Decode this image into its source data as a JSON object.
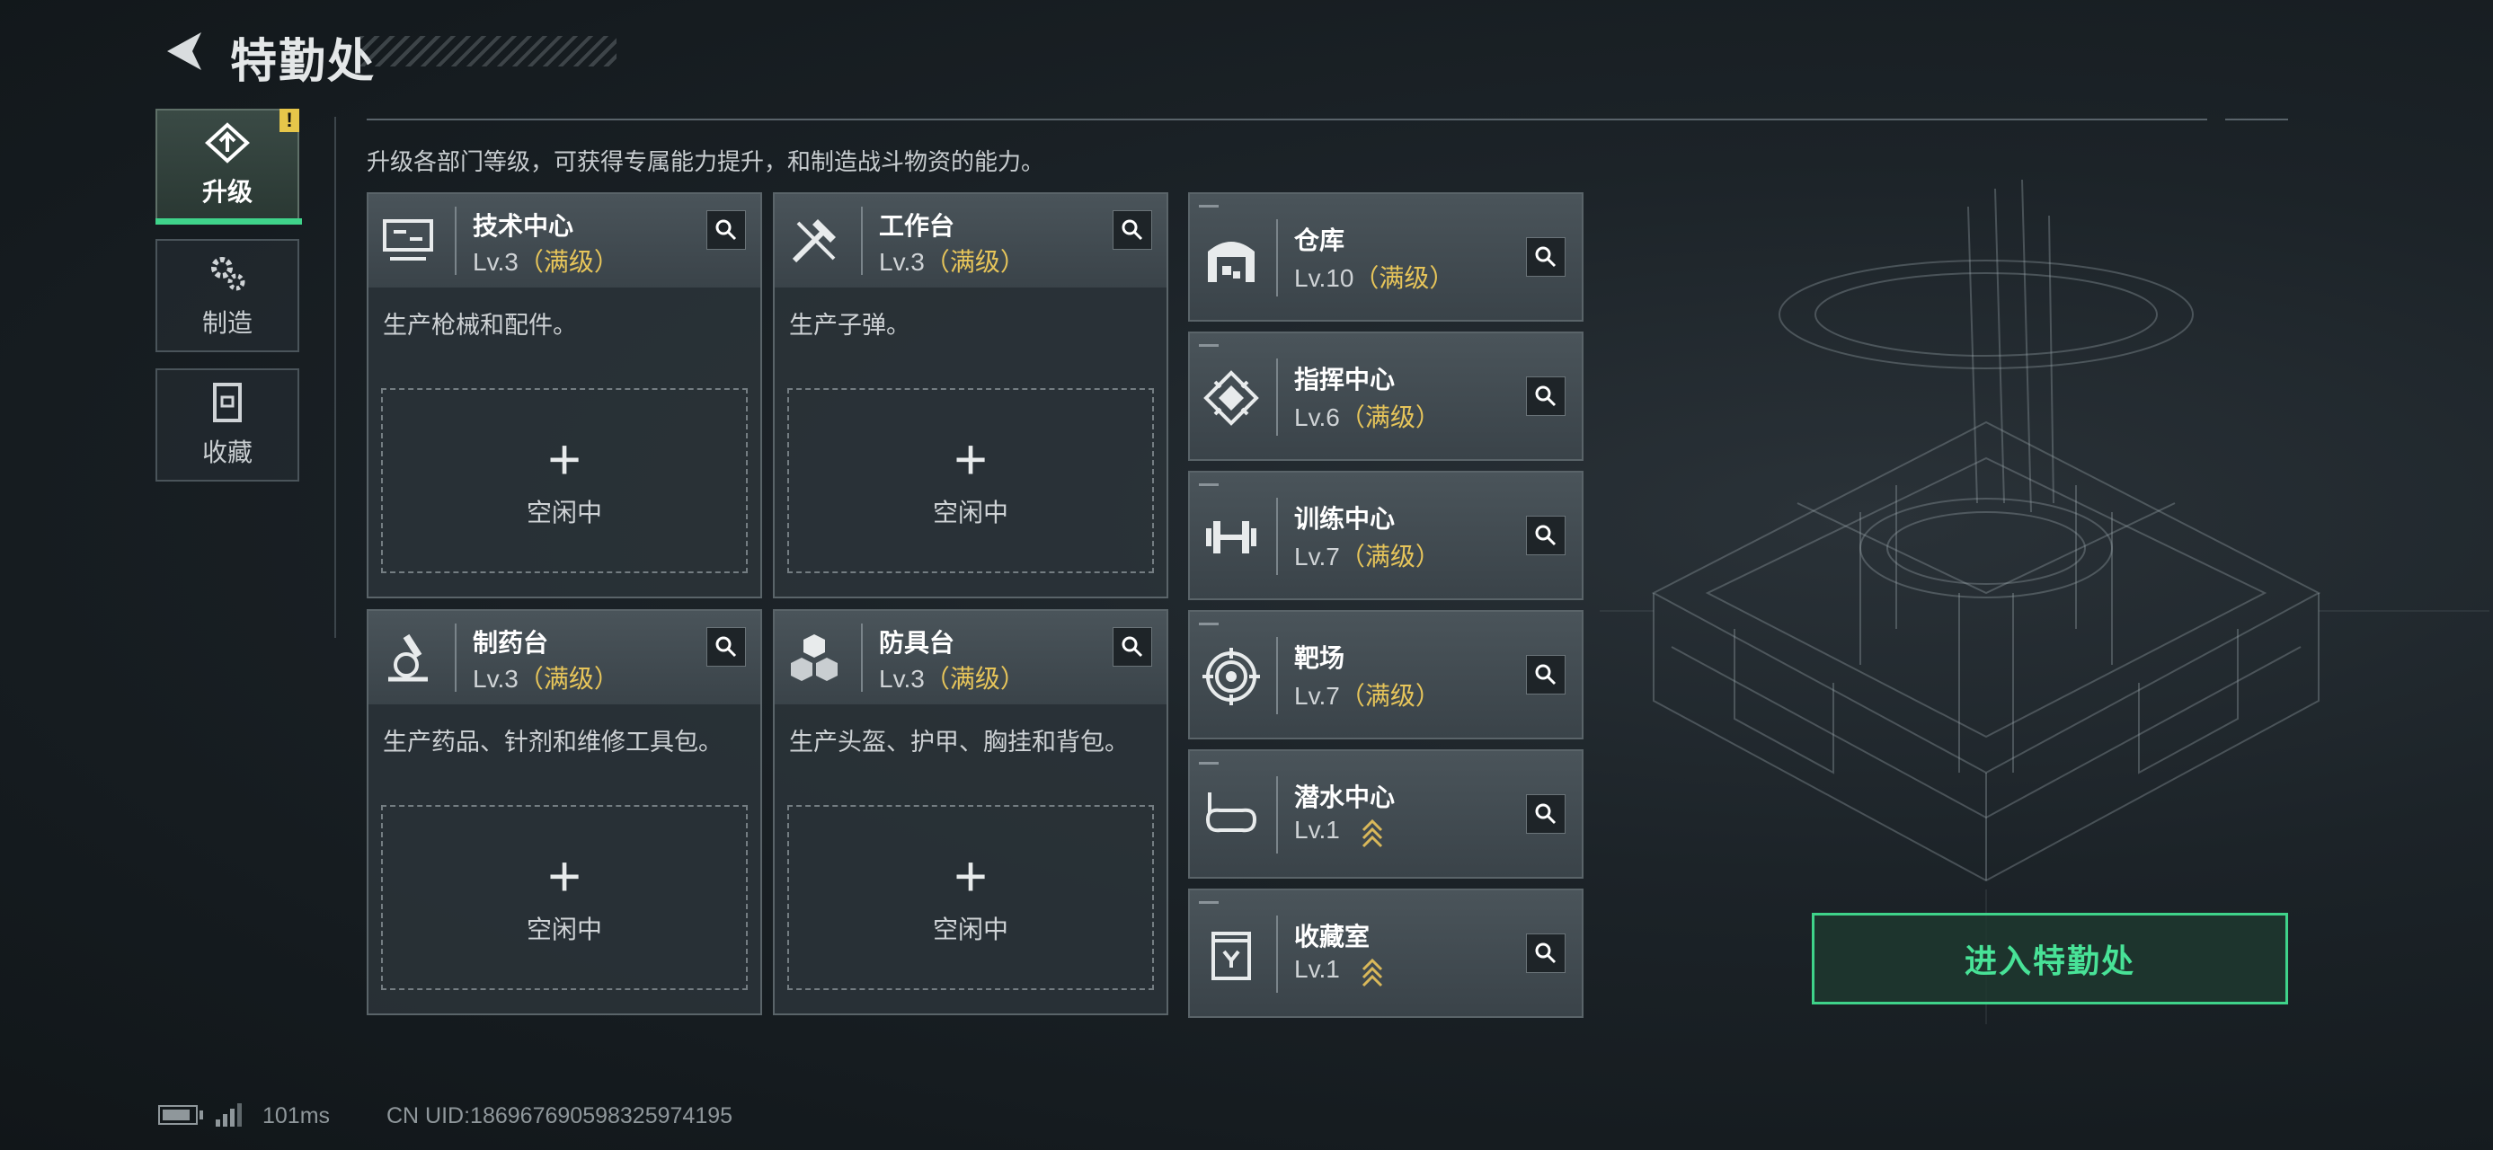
{
  "header": {
    "title": "特勤处"
  },
  "tabs": [
    {
      "label": "升级",
      "icon": "upgrade-icon",
      "active": true,
      "badge": "!"
    },
    {
      "label": "制造",
      "icon": "gears-icon",
      "active": false
    },
    {
      "label": "收藏",
      "icon": "collection-icon",
      "active": false
    }
  ],
  "description": "升级各部门等级，可获得专属能力提升，和制造战斗物资的能力。",
  "departments": [
    {
      "name": "技术中心",
      "level": "Lv.3",
      "max": "（满级）",
      "desc": "生产枪械和配件。",
      "slot_plus": "+",
      "slot_status": "空闲中",
      "icon": "computer-icon"
    },
    {
      "name": "工作台",
      "level": "Lv.3",
      "max": "（满级）",
      "desc": "生产子弹。",
      "slot_plus": "+",
      "slot_status": "空闲中",
      "icon": "tools-icon"
    },
    {
      "name": "制药台",
      "level": "Lv.3",
      "max": "（满级）",
      "desc": "生产药品、针剂和维修工具包。",
      "slot_plus": "+",
      "slot_status": "空闲中",
      "icon": "microscope-icon"
    },
    {
      "name": "防具台",
      "level": "Lv.3",
      "max": "（满级）",
      "desc": "生产头盔、护甲、胸挂和背包。",
      "slot_plus": "+",
      "slot_status": "空闲中",
      "icon": "cubes-icon"
    }
  ],
  "facilities": [
    {
      "name": "仓库",
      "level": "Lv.10",
      "max": "（满级）",
      "icon": "warehouse-icon"
    },
    {
      "name": "指挥中心",
      "level": "Lv.6",
      "max": "（满级）",
      "icon": "command-icon"
    },
    {
      "name": "训练中心",
      "level": "Lv.7",
      "max": "（满级）",
      "icon": "dumbbell-icon"
    },
    {
      "name": "靶场",
      "level": "Lv.7",
      "max": "（满级）",
      "icon": "target-icon"
    },
    {
      "name": "潜水中心",
      "level": "Lv.1",
      "max": "",
      "upgradable": true,
      "icon": "diving-mask-icon"
    },
    {
      "name": "收藏室",
      "level": "Lv.1",
      "max": "",
      "upgradable": true,
      "icon": "trophy-case-icon"
    }
  ],
  "enter_button": "进入特勤处",
  "status_bar": {
    "ping": "101ms",
    "uid": "CN UID:1869676905983259741​95"
  },
  "colors": {
    "accent_green": "#3fd38a",
    "max_level_yellow": "#e7c55a",
    "warning_yellow": "#e6c64a"
  }
}
